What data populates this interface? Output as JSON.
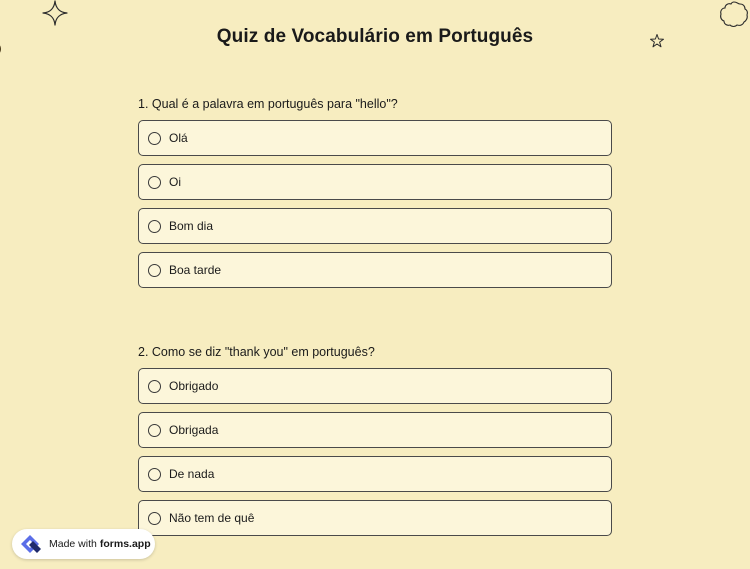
{
  "title": "Quiz de Vocabulário em Português",
  "questions": [
    {
      "text": "1.  Qual é a palavra em português para \"hello\"?",
      "options": [
        "Olá",
        "Oi",
        "Bom dia",
        "Boa tarde"
      ]
    },
    {
      "text": "2. Como se diz \"thank you\" em português?",
      "options": [
        "Obrigado",
        "Obrigada",
        "De nada",
        "Não tem de quê"
      ]
    }
  ],
  "badge": {
    "prefix": "Made with",
    "brand": "forms.app",
    "logo_icon": "forms-app-logo-icon"
  },
  "decorations": [
    "sparkle-icon",
    "flower-outline-icon",
    "star-icon",
    "half-circle-icon"
  ],
  "colors": {
    "background": "#f7edc0",
    "option_background": "#fcf6da",
    "border": "#4a4a4a",
    "logo_blue": "#5b6ee8",
    "logo_navy": "#1f2a6b"
  }
}
